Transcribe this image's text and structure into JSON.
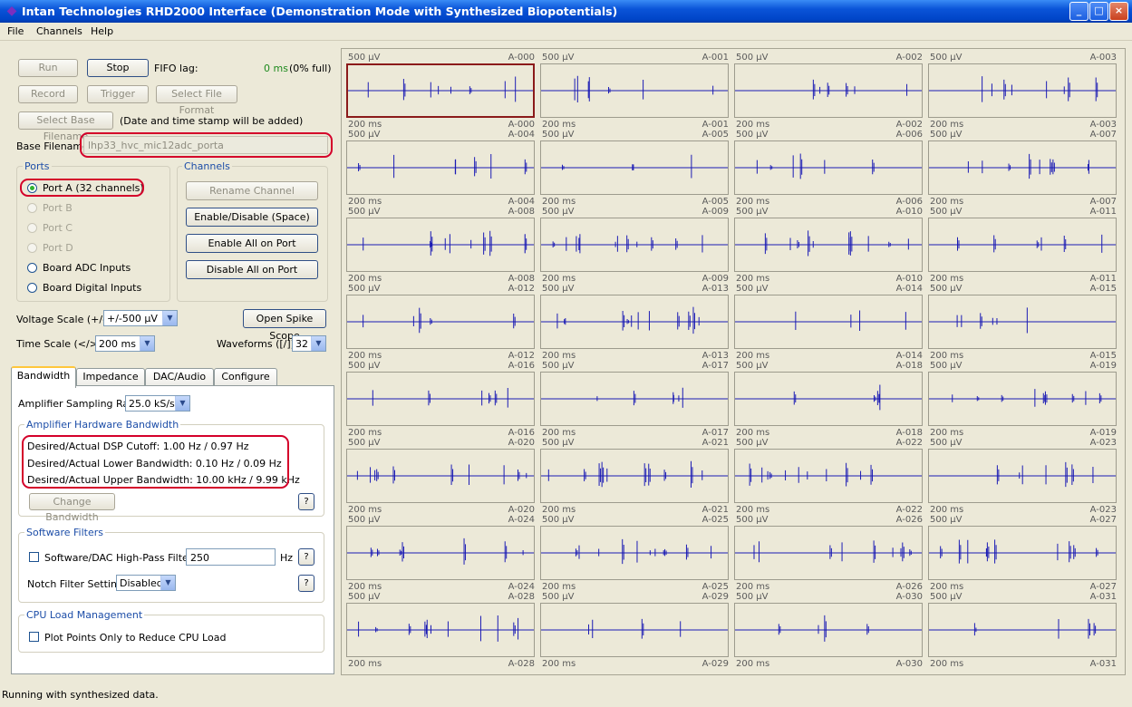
{
  "window": {
    "title": "Intan Technologies RHD2000 Interface (Demonstration Mode with Synthesized Biopotentials)"
  },
  "menu": [
    "File",
    "Channels",
    "Help"
  ],
  "controls": {
    "run": "Run",
    "stop": "Stop",
    "fifo_label": "FIFO lag:",
    "fifo_value": "0 ms",
    "fifo_full": "(0% full)",
    "record": "Record",
    "trigger": "Trigger",
    "select_file_format": "Select File Format",
    "select_base_filename": "Select Base Filename",
    "timestamp_note": "(Date and time stamp will be added)",
    "base_filename_label": "Base Filename",
    "base_filename_value": "lhp33_hvc_mic12adc_porta"
  },
  "ports": {
    "title": "Ports",
    "items": [
      "Port A (32 channels)",
      "Port B",
      "Port C",
      "Port D",
      "Board ADC Inputs",
      "Board Digital Inputs"
    ]
  },
  "channels": {
    "title": "Channels",
    "rename": "Rename Channel",
    "enable_disable": "Enable/Disable (Space)",
    "enable_all": "Enable All on Port",
    "disable_all": "Disable All on Port"
  },
  "scales": {
    "voltage_label": "Voltage Scale (+/-)",
    "voltage_value": "+/-500 µV",
    "open_spike_scope": "Open Spike Scope",
    "time_label": "Time Scale (</>)",
    "time_value": "200 ms",
    "waveforms_label": "Waveforms ([/])",
    "waveforms_value": "32"
  },
  "tabs": [
    "Bandwidth",
    "Impedance",
    "DAC/Audio",
    "Configure"
  ],
  "bandwidth": {
    "sampling_label": "Amplifier Sampling Rate",
    "sampling_value": "25.0 kS/s",
    "hw_title": "Amplifier Hardware Bandwidth",
    "dsp": "Desired/Actual DSP Cutoff: 1.00 Hz / 0.97 Hz",
    "lower": "Desired/Actual Lower Bandwidth: 0.10 Hz / 0.09 Hz",
    "upper": "Desired/Actual Upper Bandwidth: 10.00 kHz / 9.99 kHz",
    "change": "Change Bandwidth",
    "help": "?",
    "sw_title": "Software Filters",
    "hp_label": "Software/DAC High-Pass Filter",
    "hp_value": "250",
    "hp_unit": "Hz",
    "notch_label": "Notch Filter Setting",
    "notch_value": "Disabled",
    "cpu_title": "CPU Load Management",
    "plot_points": "Plot Points Only to Reduce CPU Load"
  },
  "status": "Running with synthesized data.",
  "plots": {
    "scale_label": "500 µV",
    "time_label": "200 ms",
    "channels": [
      "A-000",
      "A-001",
      "A-002",
      "A-003",
      "A-004",
      "A-005",
      "A-006",
      "A-007",
      "A-008",
      "A-009",
      "A-010",
      "A-011",
      "A-012",
      "A-013",
      "A-014",
      "A-015",
      "A-016",
      "A-017",
      "A-018",
      "A-019",
      "A-020",
      "A-021",
      "A-022",
      "A-023",
      "A-024",
      "A-025",
      "A-026",
      "A-027",
      "A-028",
      "A-029",
      "A-030",
      "A-031"
    ],
    "selected": "A-000"
  },
  "colors": {
    "trace": "#1a1ab4",
    "highlight": "#d4002a",
    "selected_plot": "#8b1a1a"
  }
}
